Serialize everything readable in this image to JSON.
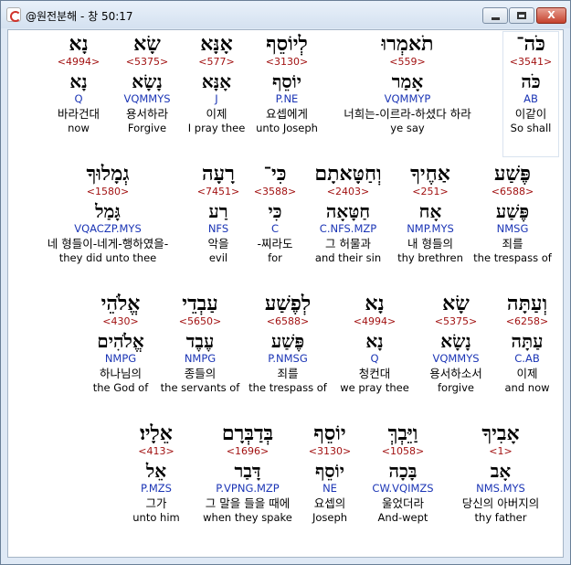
{
  "window": {
    "title": "@원전분해 - 창 50:17"
  },
  "controls": {
    "minimize": "",
    "maximize": "",
    "close": "X"
  },
  "rows": [
    [
      {
        "heb": "כֹּה־",
        "num": "<3541>",
        "lemma": "כֹּה",
        "morph": "AB",
        "kor": "이같이",
        "eng": "So shall"
      },
      {
        "heb": "תֹאמְרוּ",
        "num": "<559>",
        "lemma": "אָמַר",
        "morph": "VQMMYP",
        "kor": "너희는-이르라-하셨다 하라",
        "eng": "ye say"
      },
      {
        "heb": "לְיוֹסֵף",
        "num": "<3130>",
        "lemma": "יוֹסֵף",
        "morph": "P.NE",
        "kor": "요셉에게",
        "eng": "unto Joseph"
      },
      {
        "heb": "אָנָּא",
        "num": "<577>",
        "lemma": "אָנָּא",
        "morph": "J",
        "kor": "이제",
        "eng": "I pray thee"
      },
      {
        "heb": "שָׂא",
        "num": "<5375>",
        "lemma": "נָשָׂא",
        "morph": "VQMMYS",
        "kor": "용서하라",
        "eng": "Forgive"
      },
      {
        "heb": "נָא",
        "num": "<4994>",
        "lemma": "נָא",
        "morph": "Q",
        "kor": "바라건대",
        "eng": "now"
      }
    ],
    [
      {
        "heb": "פֶּשַׁע",
        "num": "<6588>",
        "lemma": "פֶּשַׁע",
        "morph": "NMSG",
        "kor": "죄를",
        "eng": "the trespass of"
      },
      {
        "heb": "אַחֶיךָ",
        "num": "<251>",
        "lemma": "אָח",
        "morph": "NMP.MYS",
        "kor": "내 형들의",
        "eng": "thy brethren"
      },
      {
        "heb": "וְחַטָּאתָם",
        "num": "<2403>",
        "lemma": "חַטָּאָה",
        "morph": "C.NFS.MZP",
        "kor": "그 허물과",
        "eng": "and their sin"
      },
      {
        "heb": "כִּי־",
        "num": "<3588>",
        "lemma": "כִּי",
        "morph": "C",
        "kor": "-찌라도",
        "eng": "for"
      },
      {
        "heb": "רָעָה",
        "num": "<7451>",
        "lemma": "רַע",
        "morph": "NFS",
        "kor": "악을",
        "eng": "evil"
      },
      {
        "heb": "גְמָלוּךָ",
        "num": "<1580>",
        "lemma": "גָּמַל",
        "morph": "VQACZP.MYS",
        "kor": "네 형들이-네게-행하였을-",
        "eng": "they did unto thee"
      }
    ],
    [
      {
        "heb": "וְעַתָּה",
        "num": "<6258>",
        "lemma": "עַתָּה",
        "morph": "C.AB",
        "kor": "이제",
        "eng": "and now"
      },
      {
        "heb": "שָׂא",
        "num": "<5375>",
        "lemma": "נָשָׂא",
        "morph": "VQMMYS",
        "kor": "용서하소서",
        "eng": "forgive"
      },
      {
        "heb": "נָא",
        "num": "<4994>",
        "lemma": "נָא",
        "morph": "Q",
        "kor": "청컨대",
        "eng": "we pray thee"
      },
      {
        "heb": "לְפֶשַׁע",
        "num": "<6588>",
        "lemma": "פֶּשַׁע",
        "morph": "P.NMSG",
        "kor": "죄를",
        "eng": "the trespass of"
      },
      {
        "heb": "עַבְדֵי",
        "num": "<5650>",
        "lemma": "עֶבֶד",
        "morph": "NMPG",
        "kor": "종들의",
        "eng": "the servants of"
      },
      {
        "heb": "אֱלֹהֵי",
        "num": "<430>",
        "lemma": "אֱלֹהִים",
        "morph": "NMPG",
        "kor": "하나님의",
        "eng": "the God of"
      }
    ],
    [
      {
        "heb": "אָבִיךָ",
        "num": "<1>",
        "lemma": "אָב",
        "morph": "NMS.MYS",
        "kor": "당신의 아버지의",
        "eng": "thy father"
      },
      {
        "heb": "וַיֵּבְךְּ",
        "num": "<1058>",
        "lemma": "בָּכָה",
        "morph": "CW.VQIMZS",
        "kor": "울었더라",
        "eng": "And-wept"
      },
      {
        "heb": "יוֹסֵף",
        "num": "<3130>",
        "lemma": "יוֹסֵף",
        "morph": "NE",
        "kor": "요셉의",
        "eng": "Joseph"
      },
      {
        "heb": "בְּדַבְּרָם",
        "num": "<1696>",
        "lemma": "דָּבַר",
        "morph": "P.VPNG.MZP",
        "kor": "그 말을 들을 때에",
        "eng": "when they spake"
      },
      {
        "heb": "אֵלָיו׃",
        "num": "<413>",
        "lemma": "אֵל",
        "morph": "P.MZS",
        "kor": "그가",
        "eng": "unto him"
      }
    ]
  ]
}
